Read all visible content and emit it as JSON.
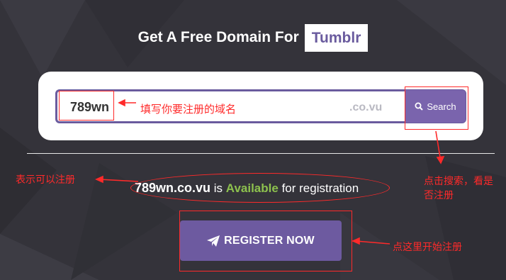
{
  "header": {
    "title": "Get A Free Domain For",
    "platform": "Tumblr"
  },
  "search": {
    "value": "789wn",
    "tld": ".co.vu",
    "button_label": "Search"
  },
  "result": {
    "domain": "789wn.co.vu",
    "is_text": "is",
    "status": "Available",
    "suffix": "for registration"
  },
  "register": {
    "label": "REGISTER NOW"
  },
  "annotations": {
    "input_hint": "填写你要注册的域名",
    "search_hint_line1": "点击搜索，看是",
    "search_hint_line2": "否注册",
    "available_hint": "表示可以注册",
    "register_hint": "点这里开始注册"
  },
  "colors": {
    "background": "#34333a",
    "accent": "#6a5b9e",
    "available": "#8dc14e",
    "annotation": "#ff2a2a"
  }
}
